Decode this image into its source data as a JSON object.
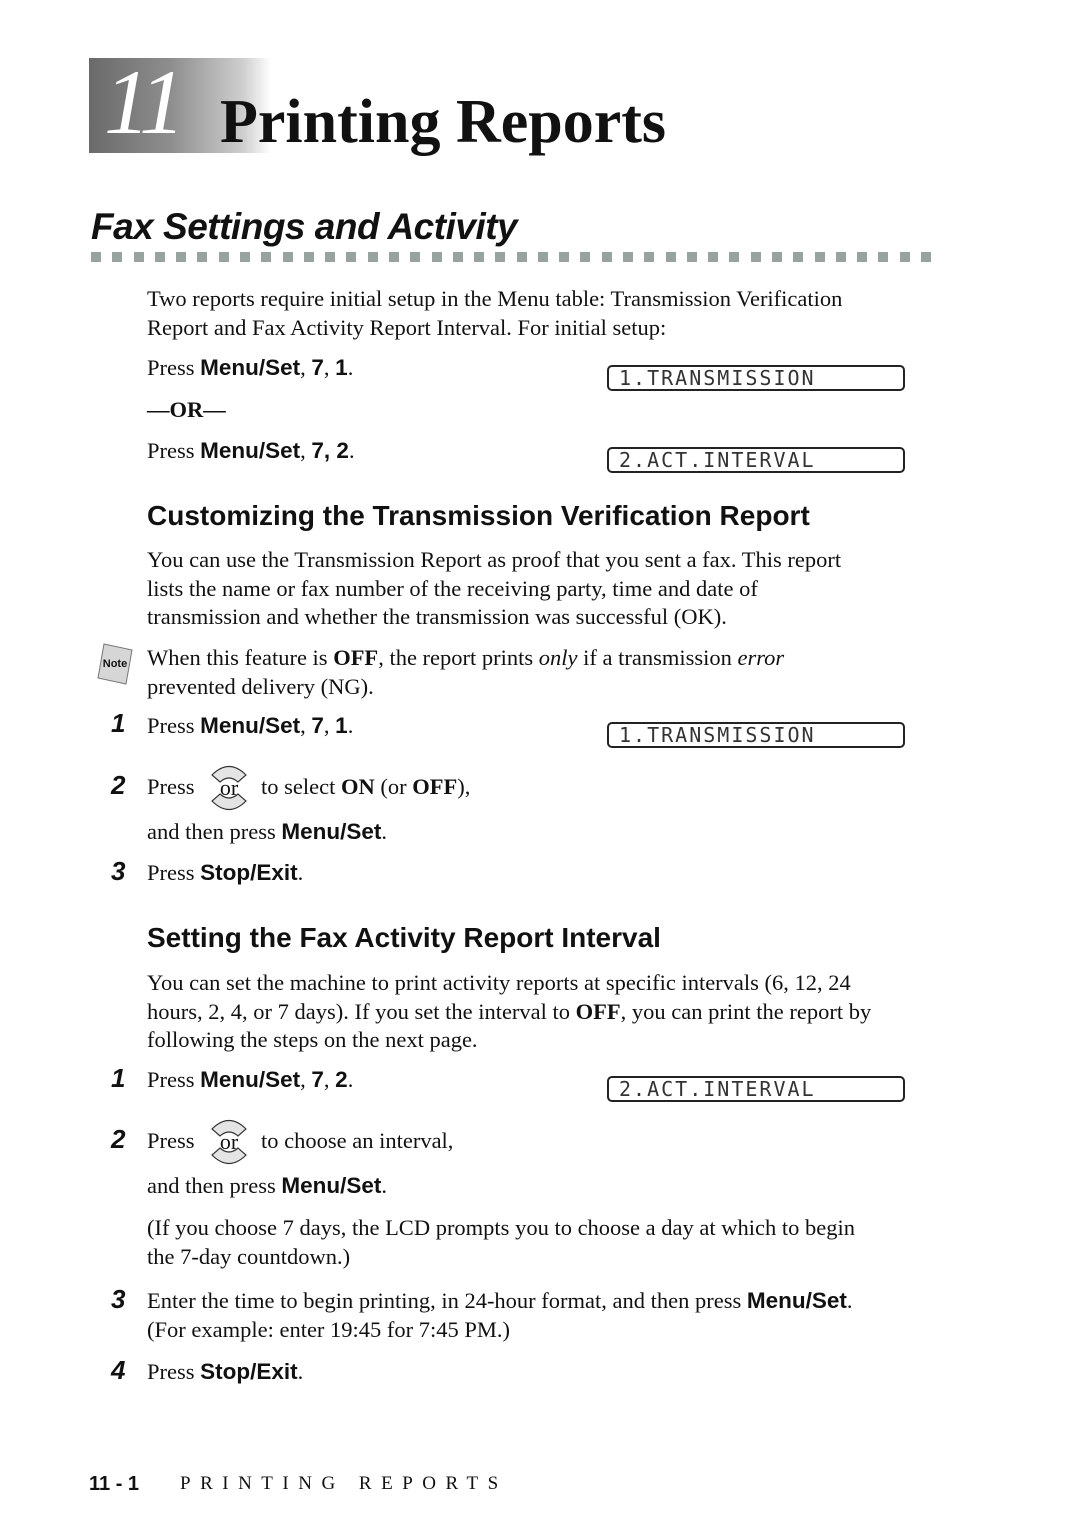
{
  "chapter": {
    "number": "11",
    "title": "Printing Reports"
  },
  "section": {
    "title": "Fax Settings and Activity"
  },
  "intro": {
    "line1": "Two reports require initial setup in the Menu table: Transmission Verification",
    "line2": "Report and Fax Activity Report Interval. For initial setup:",
    "press1": {
      "prefix": "Press ",
      "key": "Menu/Set",
      "sep1": ", ",
      "k1": "7",
      "sep2": ", ",
      "k2": "1",
      "end": "."
    },
    "or_label": "—OR—",
    "press2": {
      "prefix": "Press ",
      "key": "Menu/Set",
      "sep1": ", ",
      "k1": "7, 2",
      "end": "."
    },
    "lcd1": "1.TRANSMISSION",
    "lcd2": "2.ACT.INTERVAL"
  },
  "transmission": {
    "title": "Customizing the Transmission Verification Report",
    "para": [
      "You can use the Transmission Report as proof that you sent a fax. This report",
      "lists the name or fax number of the receiving party, time and date of",
      "transmission and whether the transmission was successful (OK)."
    ],
    "note": {
      "icon_label": "Note",
      "t1": "When this feature is ",
      "b1": "OFF",
      "t2": ", the report prints ",
      "i1": "only",
      "t3": " if a transmission ",
      "i2": "error",
      "line2": "prevented delivery (NG)."
    },
    "steps": [
      {
        "num": "1",
        "prefix": "Press ",
        "key": "Menu/Set",
        "rest": ", ",
        "k1": "7",
        "sep": ", ",
        "k2": "1",
        "end": ".",
        "lcd": "1.TRANSMISSION"
      },
      {
        "num": "2",
        "prefix": "Press",
        "or": "or",
        "t1": "to select ",
        "b1": "ON",
        "t2": " (or ",
        "b2": "OFF",
        "t3": "),",
        "line2_prefix": "and then press ",
        "line2_key": "Menu/Set",
        "line2_end": "."
      },
      {
        "num": "3",
        "prefix": "Press ",
        "key": "Stop/Exit",
        "end": "."
      }
    ]
  },
  "activity": {
    "title": "Setting the Fax Activity Report Interval",
    "para": {
      "line1": "You can set the machine to print activity reports at specific intervals (6, 12, 24",
      "line2a": "hours, 2, 4, or 7 days). If you set the interval to ",
      "line2b": "OFF",
      "line2c": ", you can print the report by",
      "line3": "following the steps on the next page."
    },
    "steps": [
      {
        "num": "1",
        "prefix": "Press ",
        "key": "Menu/Set",
        "rest": ", ",
        "k1": "7",
        "sep": ", ",
        "k2": "2",
        "end": ".",
        "lcd": "2.ACT.INTERVAL"
      },
      {
        "num": "2",
        "prefix": "Press",
        "or": "or",
        "t1": "to choose an interval,",
        "line2_prefix": "and then press ",
        "line2_key": "Menu/Set",
        "line2_end": ".",
        "note_line1": "(If you choose 7 days, the LCD prompts you to choose a day at which to begin",
        "note_line2": "the 7-day countdown.)"
      },
      {
        "num": "3",
        "t1": "Enter the time to begin printing, in 24-hour format, and then press ",
        "key": "Menu/Set",
        "end": ".",
        "line2": "(For example: enter 19:45 for 7:45 PM.)"
      },
      {
        "num": "4",
        "prefix": "Press ",
        "key": "Stop/Exit",
        "end": "."
      }
    ]
  },
  "footer": {
    "page": "11 - 1",
    "running_title": "PRINTING REPORTS"
  }
}
